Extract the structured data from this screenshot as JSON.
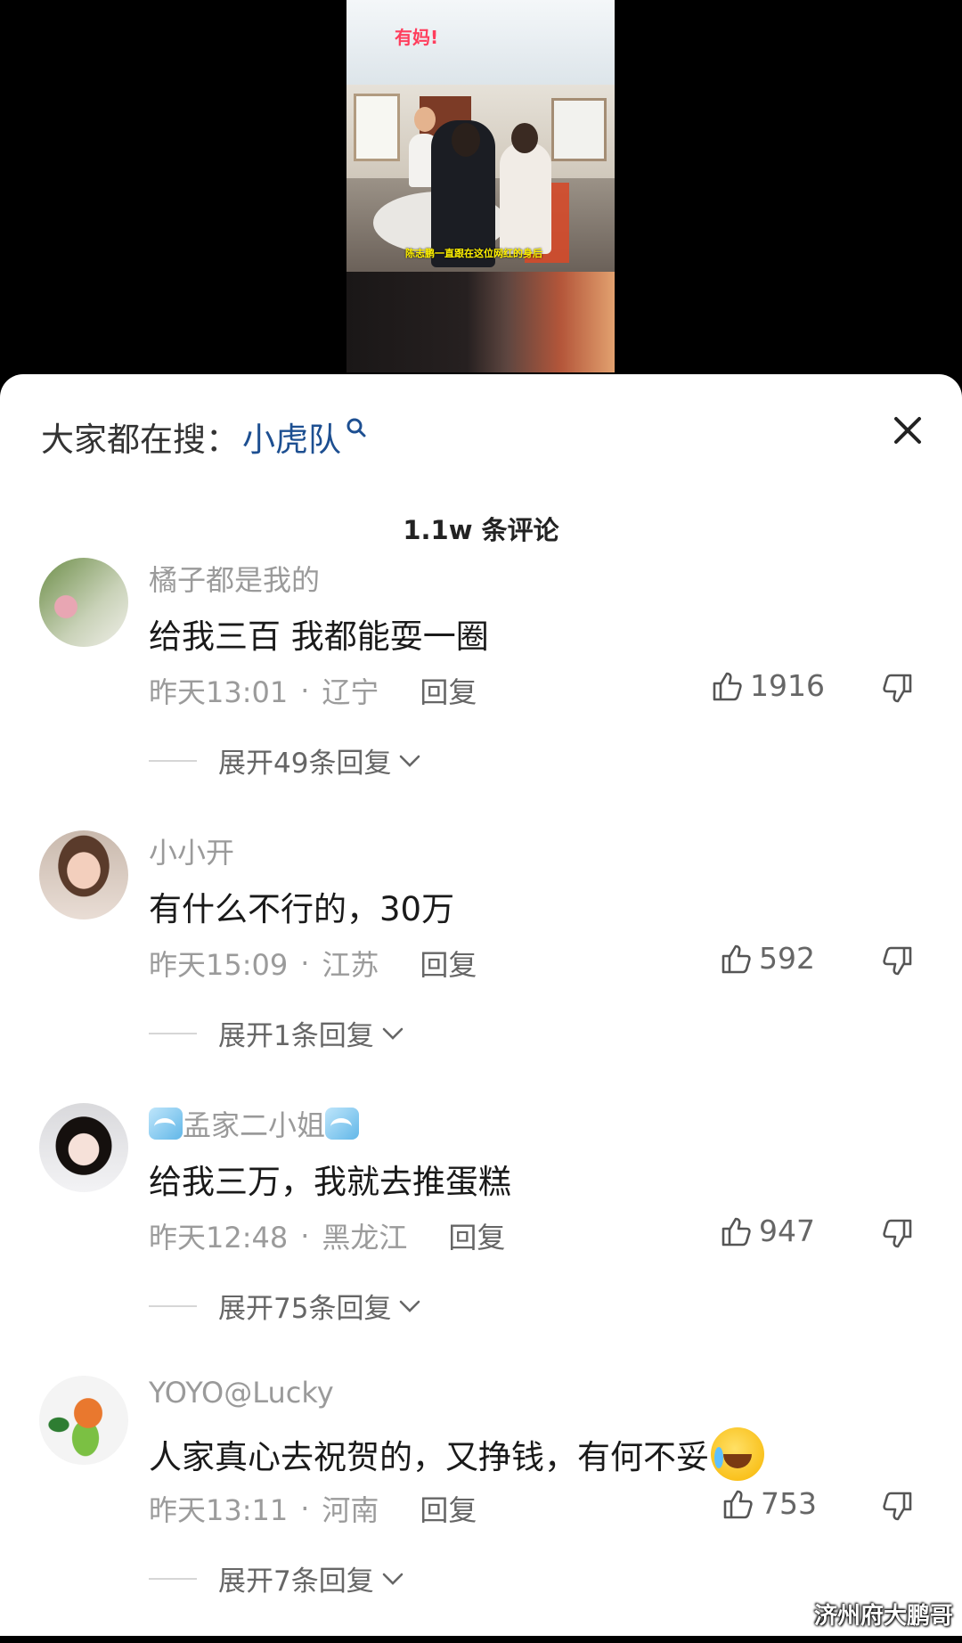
{
  "video": {
    "tag": "有妈!",
    "caption": "陈志鹏一直跟在这位网红的身后"
  },
  "search": {
    "prefix": "大家都在搜：",
    "term": "小虎队"
  },
  "comments_header": {
    "count_label": "1.1w 条评论"
  },
  "comments": [
    {
      "username": "橘子都是我的",
      "text": "给我三百 我都能耍一圈",
      "time": "昨天13:01",
      "location": "辽宁",
      "reply_label": "回复",
      "likes": "1916",
      "expand_label": "展开49条回复"
    },
    {
      "username": "小小开",
      "text": "有什么不行的，30万",
      "time": "昨天15:09",
      "location": "江苏",
      "reply_label": "回复",
      "likes": "592",
      "expand_label": "展开1条回复"
    },
    {
      "username": "孟家二小姐",
      "text": "给我三万，我就去推蛋糕",
      "time": "昨天12:48",
      "location": "黑龙江",
      "reply_label": "回复",
      "likes": "947",
      "expand_label": "展开75条回复"
    },
    {
      "username": "YOYO@Lucky",
      "text": "人家真心去祝贺的，又挣钱，有何不妥",
      "time": "昨天13:11",
      "location": "河南",
      "reply_label": "回复",
      "likes": "753",
      "expand_label": "展开7条回复"
    }
  ],
  "watermark": "济州府大鹏哥",
  "icons": {
    "close": "close-icon",
    "search": "search-icon",
    "like": "thumbs-up-icon",
    "dislike": "thumbs-down-icon",
    "expand": "chevron-down-icon"
  }
}
